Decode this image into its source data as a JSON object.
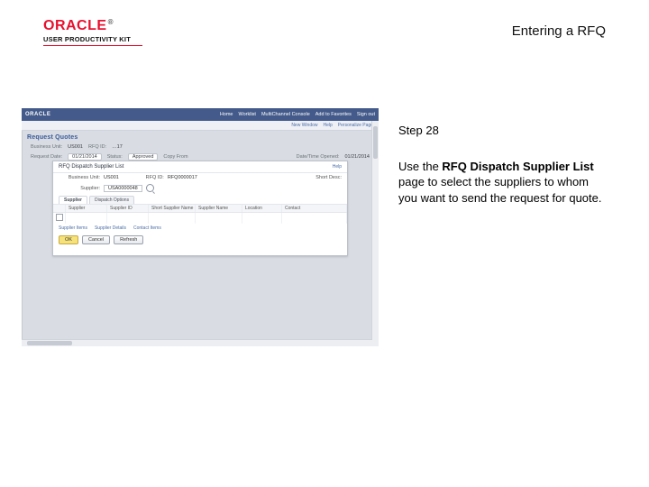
{
  "header": {
    "brand": "ORACLE",
    "tm": "®",
    "product_line": "USER PRODUCTIVITY KIT",
    "doc_title": "Entering a RFQ"
  },
  "instruction": {
    "step_label": "Step 28",
    "body_prefix": "Use the ",
    "body_bold": "RFQ Dispatch Supplier List",
    "body_suffix": " page to select the suppliers to whom you want to send the request for quote."
  },
  "shot": {
    "brand": "ORACLE",
    "nav": [
      "Home",
      "Worklist",
      "MultiChannel Console",
      "Add to Favorites",
      "Sign out"
    ],
    "subnav": [
      "New Window",
      "Help",
      "Personalize Page"
    ],
    "section_title": "Request Quotes",
    "meta": {
      "bu_label": "Business Unit:",
      "bu_value": "US001",
      "rfq_label": "RFQ ID:",
      "rfq_value": "…17",
      "req_date_label": "Request Date:",
      "req_date_value": "01/21/2014",
      "status_label": "Status:",
      "status_value": "Approved",
      "copy_label": "Copy From",
      "datetime_label": "Date/Time Opened:",
      "datetime_value": "01/21/2014"
    },
    "dialog": {
      "title": "RFQ Dispatch Supplier List",
      "help": "Help",
      "bu_label": "Business Unit:",
      "bu_value": "US001",
      "rfq_label": "RFQ ID:",
      "rfq_value": "RFQ0000017",
      "short_desc_label": "Short Desc:",
      "supplier_label": "Supplier:",
      "supplier_value": "USA0000048",
      "tabs": [
        "Supplier",
        "Dispatch Options"
      ],
      "grid": {
        "headers": [
          "",
          "Supplier",
          "Supplier ID",
          "Short Supplier Name",
          "Supplier Name",
          "Location",
          "Contact"
        ],
        "row": {
          "supplier": "",
          "supplier_id": "",
          "short_name": "",
          "name": "",
          "location": "",
          "contact": ""
        }
      },
      "links": [
        "Supplier Items",
        "Supplier Details",
        "Contact Items"
      ],
      "buttons": {
        "ok": "OK",
        "cancel": "Cancel",
        "refresh": "Refresh"
      }
    }
  }
}
